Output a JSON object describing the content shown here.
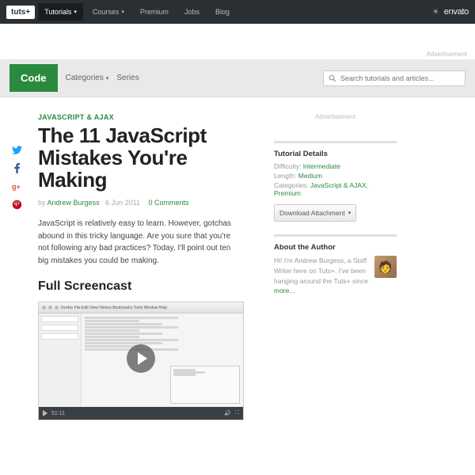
{
  "topnav": {
    "logo": "tuts",
    "logo_suffix": "+",
    "items": [
      "Tutorials",
      "Courses",
      "Premium",
      "Jobs",
      "Blog"
    ],
    "brand": "envato"
  },
  "ad_label_top": "Advertisement",
  "section_bar": {
    "tag": "Code",
    "categories": "Categories",
    "series": "Series",
    "search_placeholder": "Search tutorials and articles..."
  },
  "article": {
    "category": "JAVASCRIPT & AJAX",
    "title": "The 11 JavaScript Mistakes You're Making",
    "byline_prefix": "by",
    "author": "Andrew Burgess",
    "date": "6 Jun 2011",
    "comments": "0 Comments",
    "intro": "JavaScript is relatively easy to learn. However, gotchas abound in this tricky language. Are you sure that you're not following any bad practices? Today, I'll point out ten big mistakes you could be making.",
    "screencast_heading": "Full Screencast",
    "video_time": "51:11"
  },
  "sidebar": {
    "ad_label": "Advertisement",
    "details": {
      "heading": "Tutorial Details",
      "difficulty_key": "Difficulty:",
      "difficulty_val": "Intermediate",
      "length_key": "Length:",
      "length_val": "Medium",
      "categories_key": "Categories:",
      "categories_val": "JavaScript & AJAX, Premium",
      "download_btn": "Download Attachment"
    },
    "about": {
      "heading": "About the Author",
      "text": "Hi! I'm Andrew Burgess, a Staff Writer here on Tuts+. I've been hanging around the Tuts+ since",
      "more": "more..."
    }
  }
}
